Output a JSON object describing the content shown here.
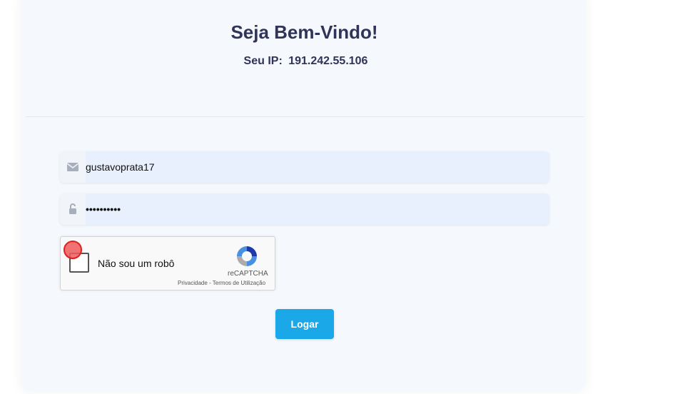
{
  "header": {
    "title": "Seja Bem-Vindo!",
    "ip_label": "Seu IP:",
    "ip_value": "191.242.55.106"
  },
  "form": {
    "username": {
      "value": "gustavoprata17",
      "icon": "envelope-icon"
    },
    "password": {
      "value": "••••••••••",
      "icon": "lock-icon"
    },
    "submit_label": "Logar"
  },
  "recaptcha": {
    "label": "Não sou um robô",
    "brand": "reCAPTCHA",
    "privacy": "Privacidade",
    "separator": "-",
    "terms": "Termos de Utilização"
  },
  "colors": {
    "title": "#2f3458",
    "button": "#1aa8e8",
    "input_bg": "#e8f0fe"
  }
}
